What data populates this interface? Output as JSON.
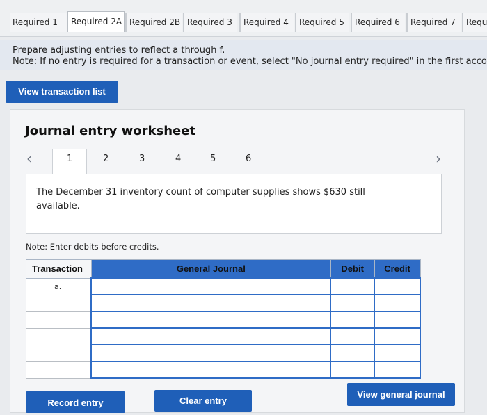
{
  "tabs": [
    "Required 1",
    "Required 2A",
    "Required 2B",
    "Required 3",
    "Required 4",
    "Required 5",
    "Required 6",
    "Required 7",
    "Requi"
  ],
  "active_tab": "Required 2A",
  "instructions": {
    "line1": "Prepare adjusting entries to reflect a through f.",
    "line2": "Note: If no entry is required for a transaction or event, select \"No journal entry required\" in the first acco"
  },
  "buttons": {
    "view_transaction_list": "View transaction list",
    "record_entry": "Record entry",
    "clear_entry": "Clear entry",
    "view_general_journal": "View general journal"
  },
  "worksheet": {
    "title": "Journal entry worksheet",
    "pages": [
      "1",
      "2",
      "3",
      "4",
      "5",
      "6"
    ],
    "current_page": "1",
    "prev_icon": "chevron-left-icon",
    "next_icon": "chevron-right-icon",
    "description": "The December 31 inventory count of computer supplies shows $630 still available.",
    "note": "Note: Enter debits before credits."
  },
  "table": {
    "headers": {
      "transaction": "Transaction",
      "general_journal": "General Journal",
      "debit": "Debit",
      "credit": "Credit"
    },
    "rows": [
      {
        "transaction": "a."
      },
      {
        "transaction": ""
      },
      {
        "transaction": ""
      },
      {
        "transaction": ""
      },
      {
        "transaction": ""
      },
      {
        "transaction": ""
      }
    ]
  },
  "colors": {
    "accent_blue": "#1f5fb8",
    "header_blue": "#2f6cc6"
  }
}
